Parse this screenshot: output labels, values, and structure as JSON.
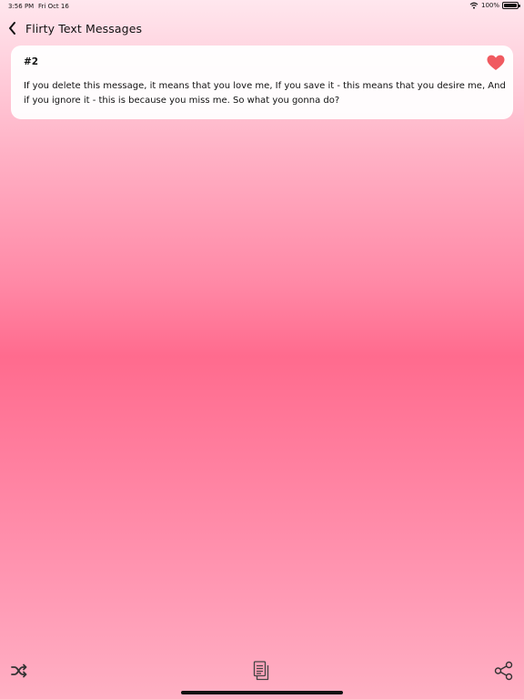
{
  "status_bar": {
    "time": "3:56 PM",
    "date": "Fri Oct 16",
    "battery": "100%",
    "battery_level": 1.0
  },
  "nav": {
    "title": "Flirty Text Messages",
    "back_icon": "chevron-left-icon"
  },
  "message": {
    "number": "#2",
    "text": "If you delete this message, it means that you love me, If you save it - this means that you desire me, And if you ignore it - this is because you miss me. So what you gonna do?",
    "favorite_icon": "heart-icon",
    "favorite_color": "#f05a60"
  },
  "toolbar": {
    "shuffle_icon": "shuffle-icon",
    "copy_icon": "copy-icon",
    "share_icon": "share-icon"
  },
  "colors": {
    "gradient_top": "#ffe7ee",
    "gradient_middle": "#ff6b8e",
    "gradient_bottom": "#ffb0c4"
  }
}
